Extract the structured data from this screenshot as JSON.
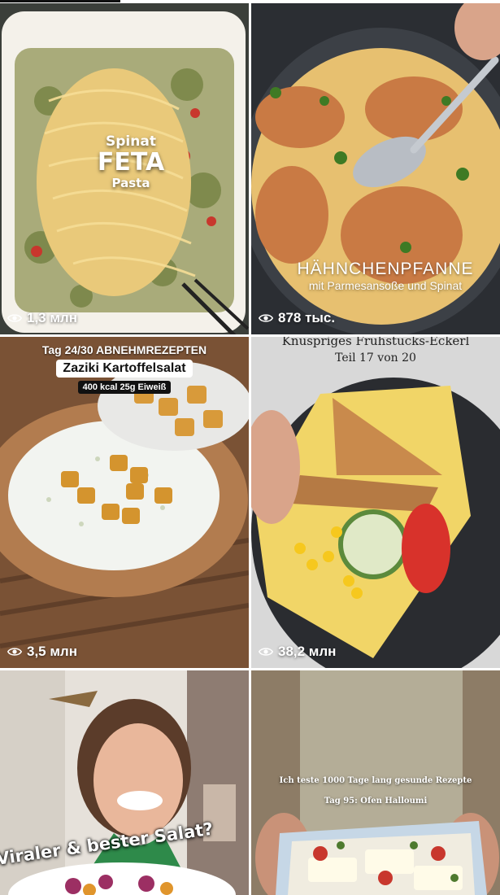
{
  "tiles": [
    {
      "views": "1,3 млн",
      "overlay": {
        "line1": "Spinat",
        "line2": "FETA",
        "line3": "Pasta"
      }
    },
    {
      "views": "878 тыс.",
      "overlay": {
        "title": "HÄHNCHENPFANNE",
        "subtitle": "mit Parmesansoße und Spinat"
      }
    },
    {
      "views": "3,5 млн",
      "overlay": {
        "day": "Tag 24/30 ABNEHMREZEPTEN",
        "title": "Zaziki Kartoffelsalat",
        "kcal": "400 kcal 25g Eiweiß"
      }
    },
    {
      "views": "38,2 млн",
      "overlay": {
        "title": "Knuspriges Frühstücks-Eckerl",
        "subtitle": "Teil 17 von 20"
      }
    },
    {
      "views": "",
      "overlay": {
        "title": "Viraler & bester Salat?"
      }
    },
    {
      "views": "",
      "overlay": {
        "title": "Ich teste 1000 Tage lang gesunde Rezepte",
        "subtitle": "Tag 95: Ofen Halloumi"
      }
    }
  ],
  "icons": {
    "views": "eye-icon"
  }
}
